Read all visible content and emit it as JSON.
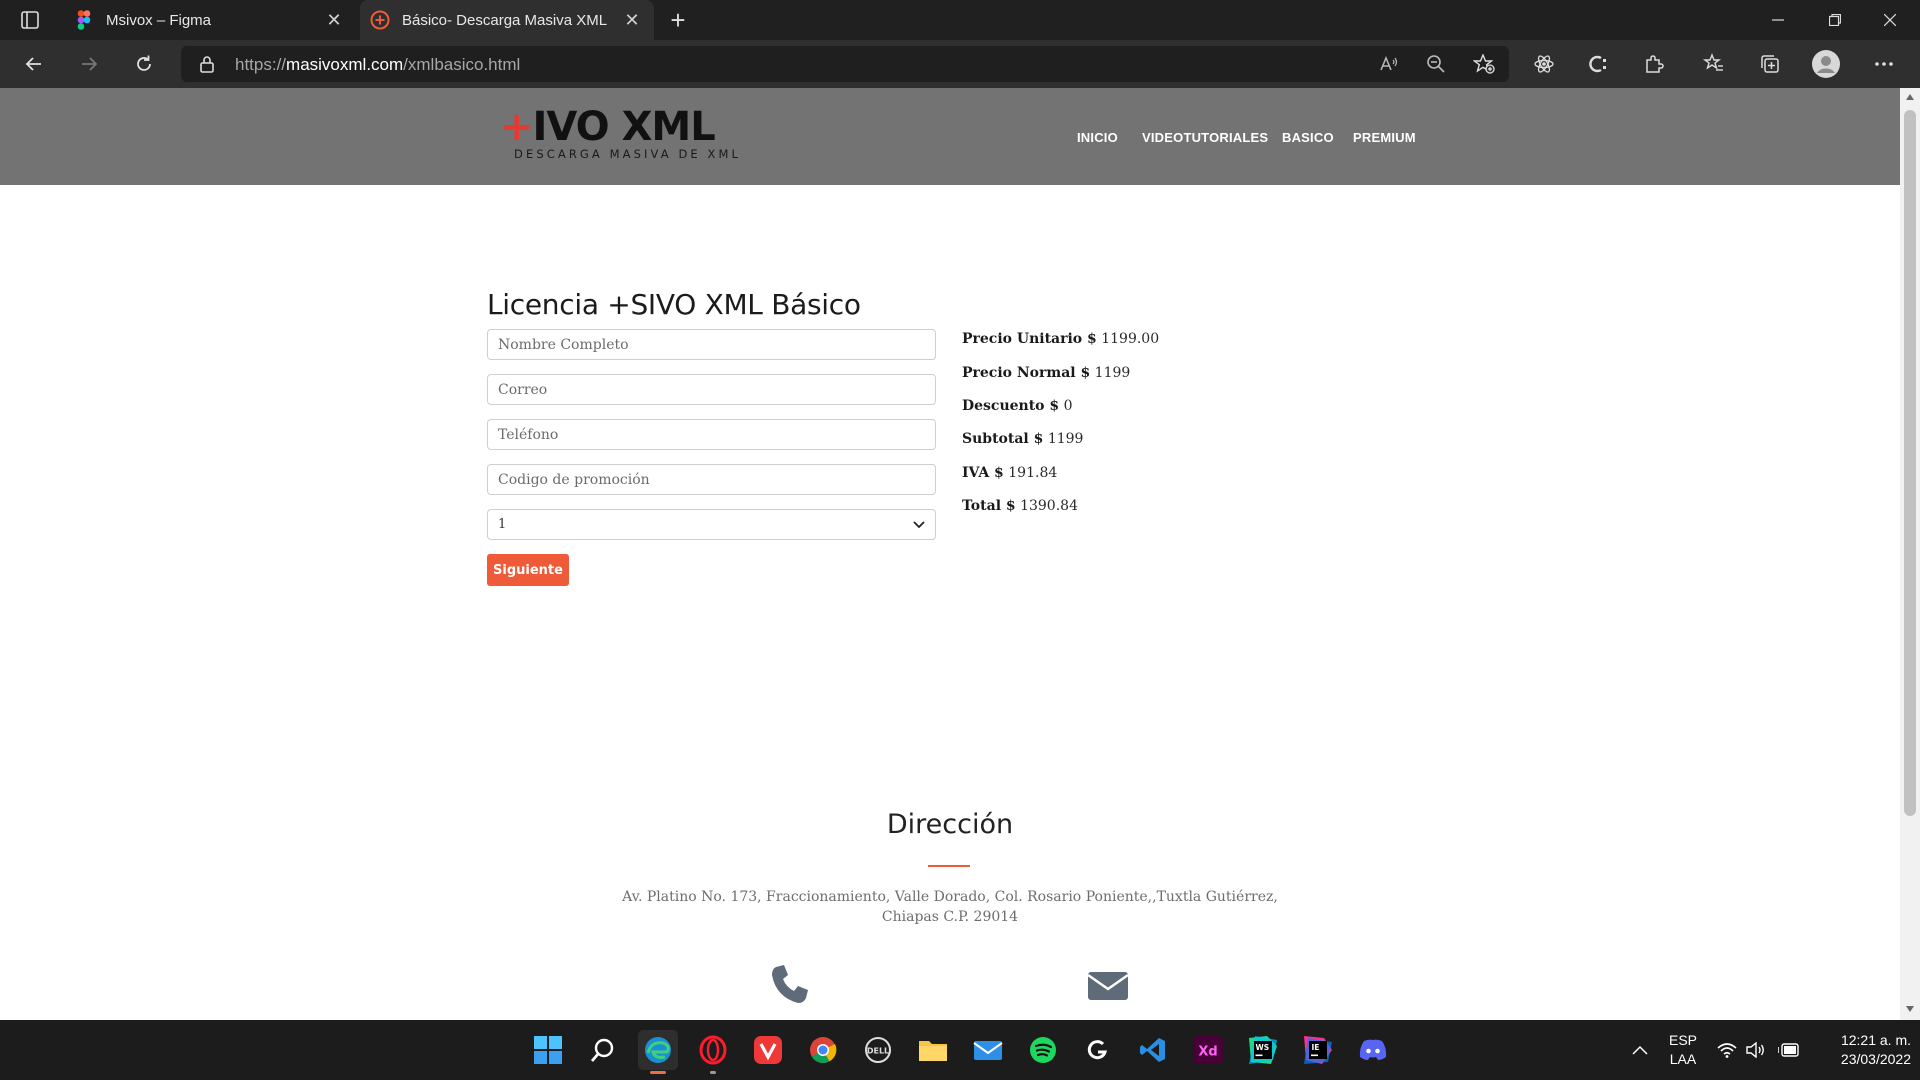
{
  "browser": {
    "tabs": [
      {
        "title": "Msivox – Figma"
      },
      {
        "title": "Básico- Descarga Masiva XML"
      }
    ],
    "url_prefix": "https://",
    "url_domain": "masivoxml.com",
    "url_path": "/xmlbasico.html"
  },
  "header": {
    "logo_text": "+IVO XML",
    "logo_tagline": "DESCARGA MASIVA DE XML",
    "nav": [
      "INICIO",
      "VIDEOTUTORIALES",
      "BASICO",
      "PREMIUM"
    ]
  },
  "form": {
    "title": "Licencia +SIVO XML Básico",
    "fields": [
      {
        "placeholder": "Nombre Completo",
        "value": ""
      },
      {
        "placeholder": "Correo",
        "value": ""
      },
      {
        "placeholder": "Teléfono",
        "value": ""
      },
      {
        "placeholder": "Codigo de promoción",
        "value": ""
      }
    ],
    "quantity_selected": "1",
    "submit_label": "Siguiente"
  },
  "summary": [
    {
      "label": "Precio Unitario $",
      "value": "1199.00"
    },
    {
      "label": "Precio Normal $",
      "value": "1199"
    },
    {
      "label": "Descuento $",
      "value": "0"
    },
    {
      "label": "Subtotal $",
      "value": "1199"
    },
    {
      "label": "IVA $",
      "value": "191.84"
    },
    {
      "label": "Total $",
      "value": "1390.84"
    }
  ],
  "address": {
    "title": "Dirección",
    "line1": "Av. Platino No. 173, Fraccionamiento, Valle Dorado, Col. Rosario Poniente,,Tuxtla Gutiérrez,",
    "line2": "Chiapas C.P. 29014"
  },
  "taskbar": {
    "lang_top": "ESP",
    "lang_bottom": "LAA",
    "time": "12:21 a. m.",
    "date": "23/03/2022"
  },
  "colors": {
    "accent": "#ef5b39",
    "header_bg": "#737373",
    "logo_plus": "#e53935"
  },
  "icons": [
    "windows-start-icon",
    "search-icon",
    "edge-icon",
    "opera-icon",
    "vivaldi-icon",
    "chrome-icon",
    "dell-icon",
    "file-explorer-icon",
    "mail-icon",
    "spotify-icon",
    "logitech-icon",
    "vscode-icon",
    "adobe-xd-icon",
    "webstorm-icon",
    "intellij-icon",
    "discord-icon",
    "phone-icon",
    "envelope-icon"
  ]
}
